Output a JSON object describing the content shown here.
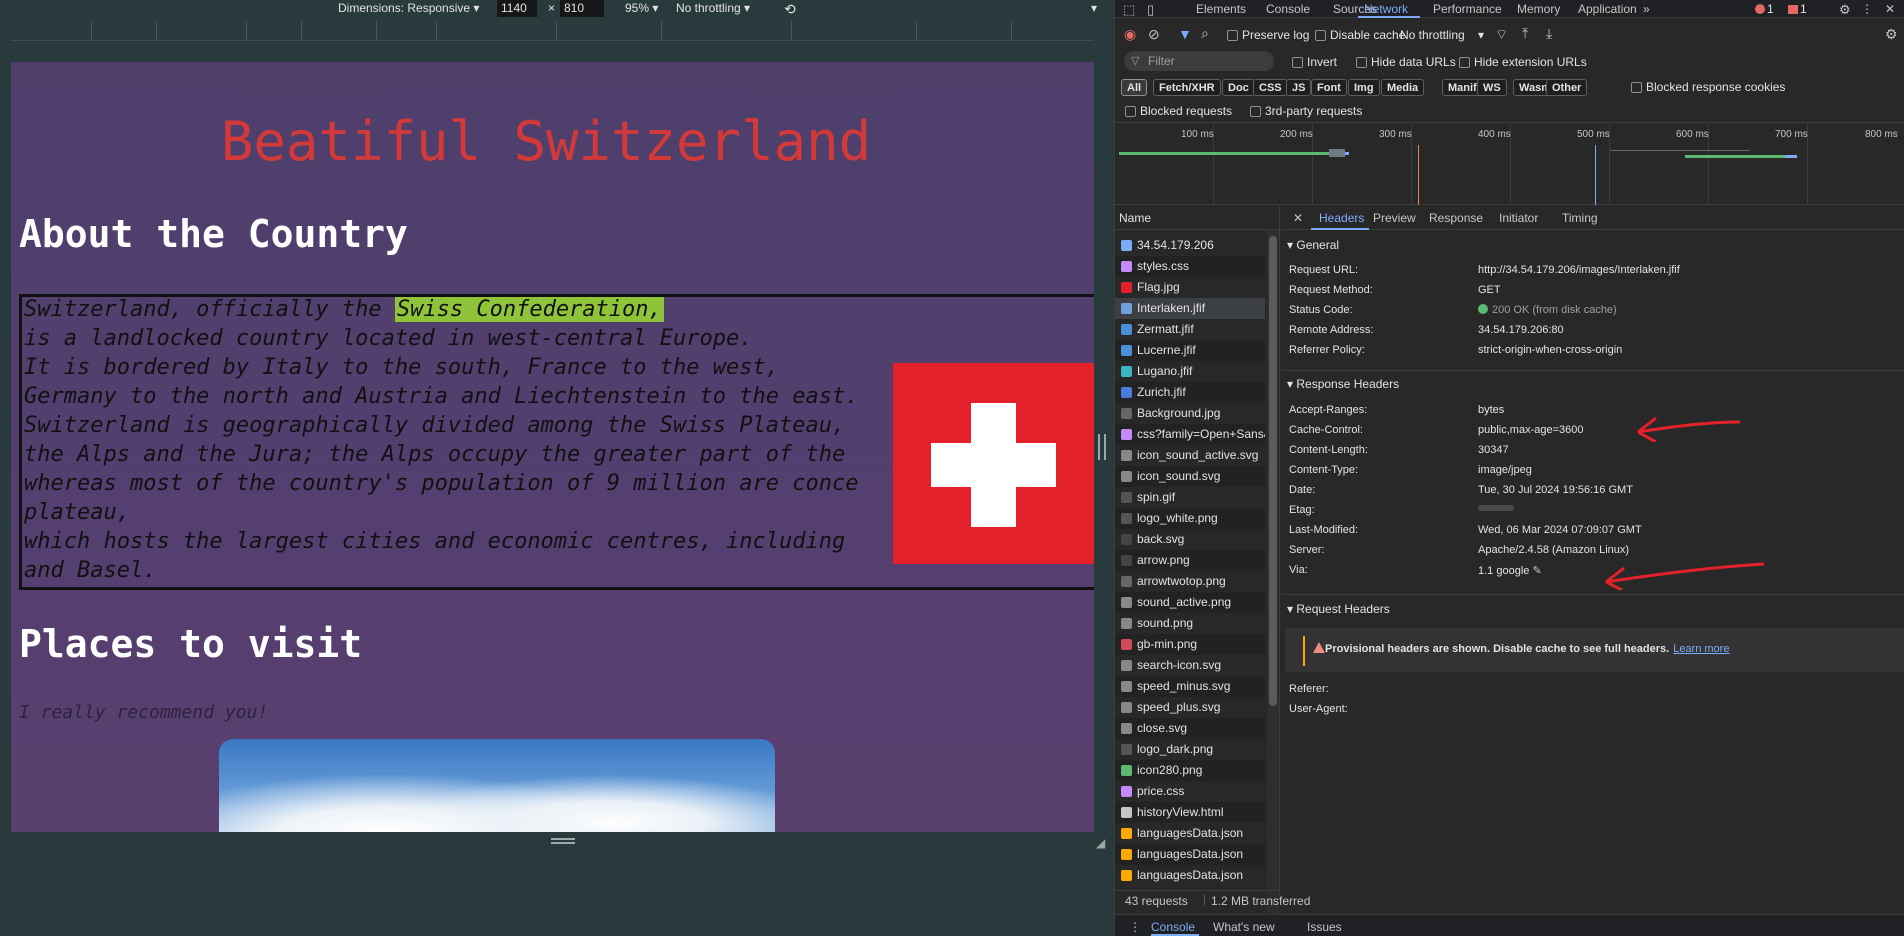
{
  "emulation": {
    "dimensions_label": "Dimensions: Responsive",
    "width": "1140",
    "times": "×",
    "height": "810",
    "zoom": "95%",
    "throttling": "No throttling"
  },
  "page": {
    "title": "Beatiful Switzerland",
    "about_heading": "About the Country",
    "about_lines": [
      "Switzerland, officially the ",
      "is a landlocked country located in west-central Europe.",
      "It is bordered by Italy to the south, France to the west,",
      "Germany to the north and Austria and Liechtenstein to the east.",
      "Switzerland is geographically divided among the Swiss Plateau,",
      "the Alps and the Jura; the Alps occupy the greater part of the",
      "whereas most of the country's population of 9 million are conce",
      "plateau,",
      "which hosts the largest cities and economic centres, including",
      "and Basel."
    ],
    "highlight": "Swiss Confederation,",
    "places_heading": "Places to visit",
    "recommend": "I really recommend you!"
  },
  "devtools": {
    "tabs": [
      "Elements",
      "Console",
      "Sources",
      "Network",
      "Performance",
      "Memory",
      "Application"
    ],
    "active_tab": "Network",
    "more": "»",
    "error_count": "1",
    "message_count": "1",
    "toolbar": {
      "preserve_log": "Preserve log",
      "disable_cache": "Disable cache",
      "throttling": "No throttling"
    },
    "filter": {
      "placeholder": "Filter",
      "invert": "Invert",
      "hide_data_urls": "Hide data URLs",
      "hide_extension_urls": "Hide extension URLs"
    },
    "types": [
      "All",
      "Fetch/XHR",
      "Doc",
      "CSS",
      "JS",
      "Font",
      "Img",
      "Media",
      "Manifest",
      "WS",
      "Wasm",
      "Other"
    ],
    "blocked_response_cookies": "Blocked response cookies",
    "blocked_requests": "Blocked requests",
    "third_party_requests": "3rd-party requests",
    "timeline_labels": [
      "100 ms",
      "200 ms",
      "300 ms",
      "400 ms",
      "500 ms",
      "600 ms",
      "700 ms",
      "800 ms"
    ],
    "name_header": "Name",
    "requests": [
      {
        "name": "34.54.179.206",
        "icon": "doc",
        "color": "#7cacf8"
      },
      {
        "name": "styles.css",
        "icon": "css",
        "color": "#c58af9"
      },
      {
        "name": "Flag.jpg",
        "icon": "img",
        "color": "#e4202a"
      },
      {
        "name": "Interlaken.jfif",
        "icon": "img",
        "color": "#6da3dc"
      },
      {
        "name": "Zermatt.jfif",
        "icon": "img",
        "color": "#4a90d9"
      },
      {
        "name": "Lucerne.jfif",
        "icon": "img",
        "color": "#4a90d9"
      },
      {
        "name": "Lugano.jfif",
        "icon": "img",
        "color": "#3cb4c6"
      },
      {
        "name": "Zurich.jfif",
        "icon": "img",
        "color": "#4a7bd9"
      },
      {
        "name": "Background.jpg",
        "icon": "img",
        "color": "#666666"
      },
      {
        "name": "css?family=Open+Sans&dis...",
        "icon": "css",
        "color": "#c58af9"
      },
      {
        "name": "icon_sound_active.svg",
        "icon": "img",
        "color": "#888888"
      },
      {
        "name": "icon_sound.svg",
        "icon": "img",
        "color": "#888888"
      },
      {
        "name": "spin.gif",
        "icon": "img",
        "color": "#555555"
      },
      {
        "name": "logo_white.png",
        "icon": "img",
        "color": "#555555"
      },
      {
        "name": "back.svg",
        "icon": "img",
        "color": "#444444"
      },
      {
        "name": "arrow.png",
        "icon": "img",
        "color": "#444444"
      },
      {
        "name": "arrowtwotop.png",
        "icon": "img",
        "color": "#666666"
      },
      {
        "name": "sound_active.png",
        "icon": "img",
        "color": "#888888"
      },
      {
        "name": "sound.png",
        "icon": "img",
        "color": "#888888"
      },
      {
        "name": "gb-min.png",
        "icon": "img",
        "color": "#d04a5a"
      },
      {
        "name": "search-icon.svg",
        "icon": "img",
        "color": "#888888"
      },
      {
        "name": "speed_minus.svg",
        "icon": "img",
        "color": "#888888"
      },
      {
        "name": "speed_plus.svg",
        "icon": "img",
        "color": "#888888"
      },
      {
        "name": "close.svg",
        "icon": "img",
        "color": "#888888"
      },
      {
        "name": "logo_dark.png",
        "icon": "img",
        "color": "#555555"
      },
      {
        "name": "icon280.png",
        "icon": "img",
        "color": "#5bb974"
      },
      {
        "name": "price.css",
        "icon": "css",
        "color": "#c58af9"
      },
      {
        "name": "historyView.html",
        "icon": "doc",
        "color": "#c4c7c5"
      },
      {
        "name": "languagesData.json",
        "icon": "json",
        "color": "#f9ab00"
      },
      {
        "name": "languagesData.json",
        "icon": "json",
        "color": "#f9ab00"
      },
      {
        "name": "languagesData.json",
        "icon": "json",
        "color": "#f9ab00"
      }
    ],
    "selected_request": "Interlaken.jfif",
    "detail_tabs": [
      "Headers",
      "Preview",
      "Response",
      "Initiator",
      "Timing"
    ],
    "active_detail_tab": "Headers",
    "general": {
      "title": "General",
      "rows": [
        {
          "k": "Request URL:",
          "v": "http://34.54.179.206/images/Interlaken.jfif"
        },
        {
          "k": "Request Method:",
          "v": "GET"
        },
        {
          "k": "Status Code:",
          "v": "200 OK (from disk cache)"
        },
        {
          "k": "Remote Address:",
          "v": "34.54.179.206:80"
        },
        {
          "k": "Referrer Policy:",
          "v": "strict-origin-when-cross-origin"
        }
      ]
    },
    "response_headers": {
      "title": "Response Headers",
      "rows": [
        {
          "k": "Accept-Ranges:",
          "v": "bytes"
        },
        {
          "k": "Cache-Control:",
          "v": "public,max-age=3600"
        },
        {
          "k": "Content-Length:",
          "v": "30347"
        },
        {
          "k": "Content-Type:",
          "v": "image/jpeg"
        },
        {
          "k": "Date:",
          "v": "Tue, 30 Jul 2024 19:56:16 GMT"
        },
        {
          "k": "Etag:",
          "v": ""
        },
        {
          "k": "Last-Modified:",
          "v": "Wed, 06 Mar 2024 07:09:07 GMT"
        },
        {
          "k": "Server:",
          "v": "Apache/2.4.58 (Amazon Linux)"
        },
        {
          "k": "Via:",
          "v": "1.1 google"
        }
      ]
    },
    "request_headers": {
      "title": "Request Headers",
      "provisional": "Provisional headers are shown. Disable cache to see full headers.",
      "learn_more": "Learn more",
      "rows": [
        {
          "k": "Referer:",
          "v": ""
        },
        {
          "k": "User-Agent:",
          "v": ""
        }
      ]
    },
    "status": {
      "requests": "43 requests",
      "transferred": "1.2 MB transferred"
    },
    "drawer": [
      "Console",
      "What's new",
      "Issues"
    ]
  }
}
